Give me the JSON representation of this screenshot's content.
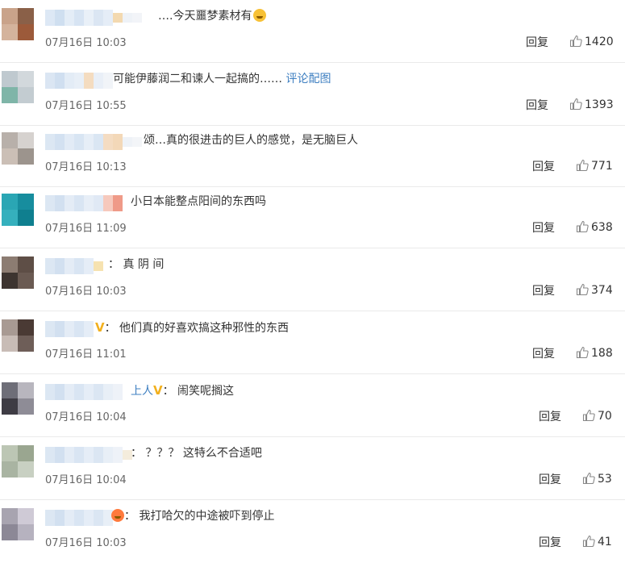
{
  "reply_label": "回复",
  "comments": [
    {
      "content": "….今天噩梦素材有",
      "emoji": "grinning-sweat-emoji",
      "time": "07月16日 10:03",
      "likes": "1420"
    },
    {
      "content": "可能伊藤润二和谏人一起搞的……",
      "link": "评论配图",
      "time": "07月16日 10:55",
      "likes": "1393"
    },
    {
      "content": "颂…真的很进击的巨人的感觉，是无脑巨人",
      "time": "07月16日 10:13",
      "likes": "771"
    },
    {
      "content": "小日本能整点阳间的东西吗",
      "time": "07月16日 11:09",
      "likes": "638"
    },
    {
      "content": "：  真 阴 间",
      "time": "07月16日 10:03",
      "likes": "374"
    },
    {
      "content": "：  他们真的好喜欢搞这种邪性的东西",
      "vip": "V",
      "time": "07月16日 11:01",
      "likes": "188"
    },
    {
      "name_tail": "上人",
      "vip": "V",
      "content": "：  闹笑呢搁这",
      "time": "07月16日 10:04",
      "likes": "70"
    },
    {
      "content": "：  ？？？ 这特么不合适吧",
      "time": "07月16日 10:04",
      "likes": "53"
    },
    {
      "content": "：  我打哈欠的中途被吓到停止",
      "emoji": "crown-emoji",
      "time": "07月16日 10:03",
      "likes": "41"
    }
  ]
}
